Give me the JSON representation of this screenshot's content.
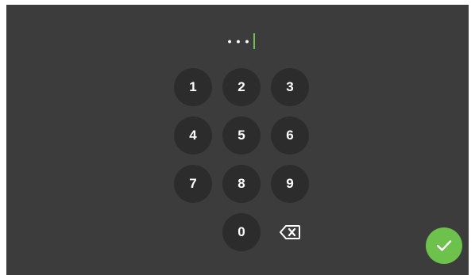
{
  "pin": {
    "masked_value": "•••",
    "caret_color": "#6cc24a"
  },
  "keypad": {
    "keys": [
      "1",
      "2",
      "3",
      "4",
      "5",
      "6",
      "7",
      "8",
      "9",
      "0"
    ]
  },
  "actions": {
    "backspace_icon": "backspace-icon",
    "confirm_icon": "check-icon",
    "confirm_color": "#6cc24a"
  },
  "colors": {
    "background": "#3c3c3c",
    "key_background": "#2c2c2c",
    "text": "#ffffff"
  }
}
